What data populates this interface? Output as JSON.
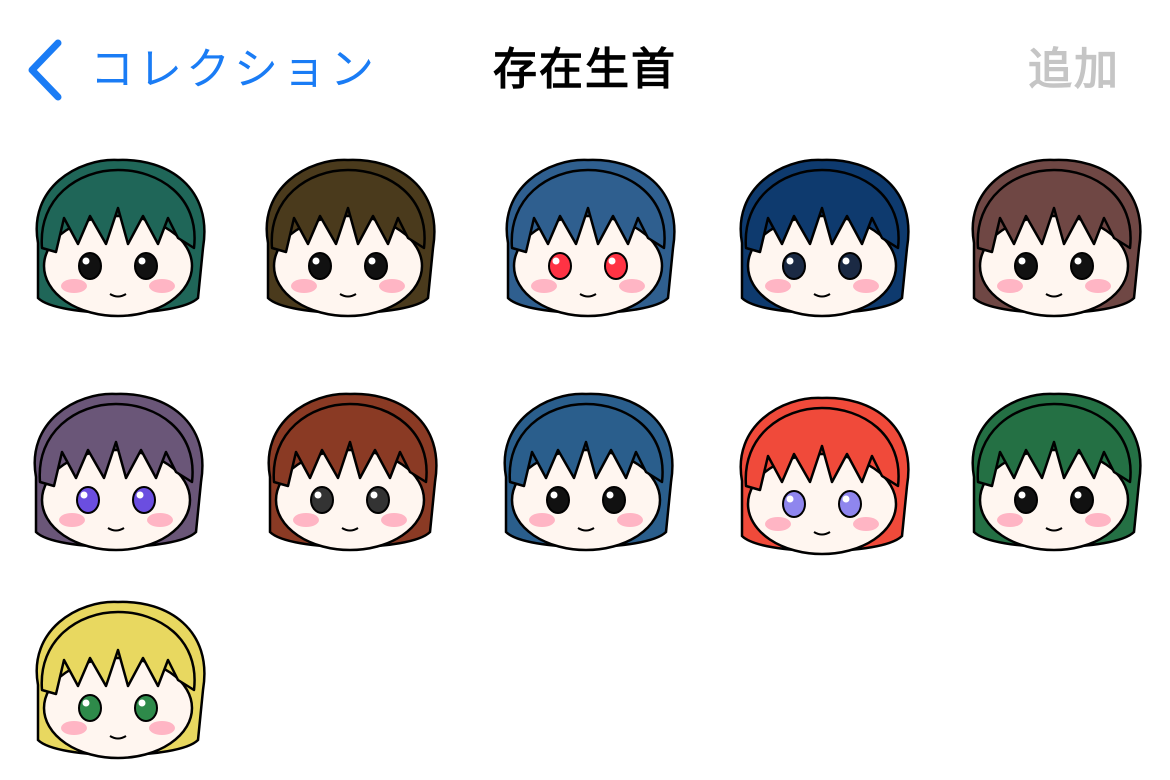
{
  "nav": {
    "back_label": "コレクション",
    "title": "存在生首",
    "add_label": "追加"
  },
  "colors": {
    "accent": "#1a7cf5",
    "disabled": "#c5c5c5"
  },
  "stickers": [
    {
      "name": "sticker-teal-pigtails",
      "hair": "#1f6658",
      "eyes": "#111111"
    },
    {
      "name": "sticker-brown-pigtails",
      "hair": "#4a3a1c",
      "eyes": "#111111"
    },
    {
      "name": "sticker-blue-red-glasses",
      "hair": "#2f5f8f",
      "eyes": "#ff3344"
    },
    {
      "name": "sticker-navy-open-mouth",
      "hair": "#0e3a6e",
      "eyes": "#1b2a44"
    },
    {
      "name": "sticker-mauve-hair",
      "hair": "#6f4744",
      "eyes": "#111111"
    },
    {
      "name": "sticker-purple-pigtails",
      "hair": "#6a5678",
      "eyes": "#6b4ee0"
    },
    {
      "name": "sticker-auburn-hair",
      "hair": "#8a3a24",
      "eyes": "#333333"
    },
    {
      "name": "sticker-blue-sweat",
      "hair": "#2a5e8c",
      "eyes": "#111111"
    },
    {
      "name": "sticker-red-ponytail",
      "hair": "#f04a3a",
      "eyes": "#8f86ee"
    },
    {
      "name": "sticker-green-hair",
      "hair": "#247044",
      "eyes": "#111111"
    },
    {
      "name": "sticker-blonde-hair",
      "hair": "#e8d860",
      "eyes": "#2e8a4a"
    }
  ]
}
